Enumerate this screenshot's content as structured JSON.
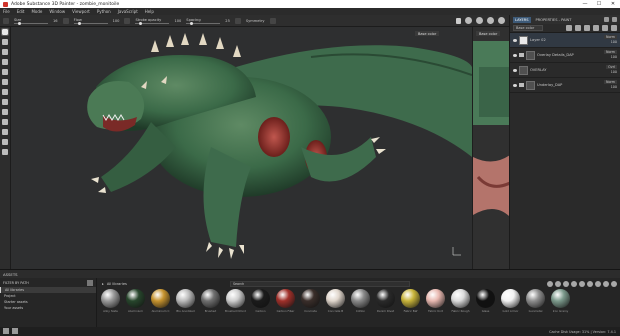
{
  "window": {
    "title": "Adobe Substance 3D Painter - zombie_monitoile",
    "controls": [
      "—",
      "☐",
      "✕"
    ]
  },
  "menu": [
    "File",
    "Edit",
    "Mode",
    "Window",
    "Viewport",
    "Python",
    "JavaScript",
    "Help"
  ],
  "tool_options": {
    "size_label": "Size",
    "size_value": "16",
    "flow_label": "Flow",
    "flow_value": "100",
    "stroke_label": "Stroke opacity",
    "stroke_value": "100",
    "spacing_label": "Spacing",
    "spacing_value": "25",
    "symmetry_label": "Symmetry"
  },
  "viewport": {
    "color_label": "Base color",
    "uv_label": "Base color"
  },
  "right_panel": {
    "tabs": [
      "LAYERS",
      "PROPERTIES - PAINT"
    ],
    "channel": "Base color",
    "layers": [
      {
        "name": "Layer 02",
        "mode": "Norm",
        "opacity": "100",
        "type": "paint"
      },
      {
        "name": "Overlay Details_DAP",
        "mode": "Norm",
        "opacity": "100",
        "type": "folder"
      },
      {
        "name": "OVERLAY",
        "mode": "Ovrl",
        "opacity": "100",
        "type": "fill"
      },
      {
        "name": "Underlay_DAP",
        "mode": "Norm",
        "opacity": "100",
        "type": "folder"
      }
    ]
  },
  "assets": {
    "title": "ASSETS",
    "filter_label": "FILTER BY PATH",
    "libraries": [
      "All libraries",
      "Project",
      "Starter assets",
      "Your assets"
    ],
    "breadcrumb": "All libraries",
    "search_placeholder": "Search",
    "items": [
      {
        "label": "Alloy Slate",
        "color": "#9a9a9a"
      },
      {
        "label": "Aluminium",
        "color": "#27462c"
      },
      {
        "label": "Aluminium C",
        "color": "#c6932e"
      },
      {
        "label": "Blu Anodized",
        "color": "#bcbcbc"
      },
      {
        "label": "Brushed",
        "color": "#707070"
      },
      {
        "label": "Brushed Dmnd",
        "color": "#cfcfcf"
      },
      {
        "label": "Carbon",
        "color": "#1b1b1b"
      },
      {
        "label": "Carbon Fiber",
        "color": "#a0302a"
      },
      {
        "label": "Concrete",
        "color": "#3a2e2a"
      },
      {
        "label": "Concrete B",
        "color": "#e0d6cc"
      },
      {
        "label": "Cotton",
        "color": "#8a8a8a"
      },
      {
        "label": "Denim Rivet",
        "color": "#2a2a2a"
      },
      {
        "label": "Fabric Baf",
        "color": "#c8b43a"
      },
      {
        "label": "Fabric Knit",
        "color": "#e8b8b0"
      },
      {
        "label": "Fabric Rough",
        "color": "#dcdcdc"
      },
      {
        "label": "Glass",
        "color": "#111111"
      },
      {
        "label": "Gold Armor",
        "color": "#f2f2f2"
      },
      {
        "label": "Gunmetal",
        "color": "#8e8e8e"
      },
      {
        "label": "Iron Grainy",
        "color": "#7c9a8c"
      }
    ]
  },
  "status": {
    "text": "Cache Disk Usage: 31% | Version: 7.4.1"
  },
  "colors": {
    "accent": "#3d5a78",
    "dragon": "#2f5a3c",
    "wound": "#8a2a25"
  }
}
